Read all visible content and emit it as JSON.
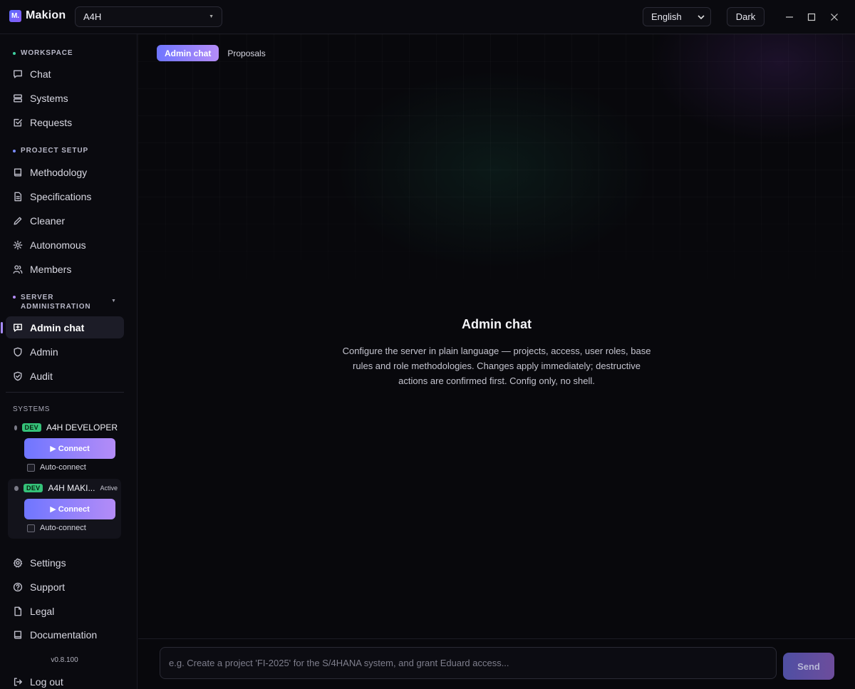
{
  "app": {
    "logo_mark": "M.",
    "name": "Makion",
    "project": "A4H",
    "language": "English",
    "theme": "Dark"
  },
  "sidebar": {
    "workspace_title": "WORKSPACE",
    "project_setup_title": "PROJECT SETUP",
    "server_admin_title": "SERVER ADMINISTRATION",
    "workspace_items": [
      "Chat",
      "Systems",
      "Requests"
    ],
    "project_items": [
      "Methodology",
      "Specifications",
      "Cleaner",
      "Autonomous",
      "Members"
    ],
    "admin_items": [
      "Admin chat",
      "Admin",
      "Audit"
    ],
    "systems_title": "SYSTEMS",
    "systems": [
      {
        "badge": "DEV",
        "name": "A4H DEVELOPER",
        "status": "",
        "connect_label": "▶ Connect",
        "auto_label": "Auto-connect"
      },
      {
        "badge": "DEV",
        "name": "A4H MAKI...",
        "status": "Active",
        "connect_label": "▶ Connect",
        "auto_label": "Auto-connect"
      }
    ],
    "footer_items": [
      "Settings",
      "Support",
      "Legal",
      "Documentation"
    ],
    "version": "v0.8.100",
    "logout": "Log out"
  },
  "main": {
    "tabs": [
      "Admin chat",
      "Proposals"
    ],
    "empty_title": "Admin chat",
    "empty_desc": "Configure the server in plain language — projects, access, user roles, base rules and role methodologies. Changes apply immediately; destructive actions are confirmed first. Config only, no shell.",
    "composer_placeholder": "e.g. Create a project 'FI-2025' for the S/4HANA system, and grant Eduard access...",
    "send_label": "Send"
  },
  "colors": {
    "accent_start": "#6f76ff",
    "accent_end": "#b48cf7",
    "dev_badge": "#35c279",
    "workspace_dot": "#3fd1a0",
    "setup_dot": "#7b8cff",
    "admin_dot": "#b38cf7"
  }
}
